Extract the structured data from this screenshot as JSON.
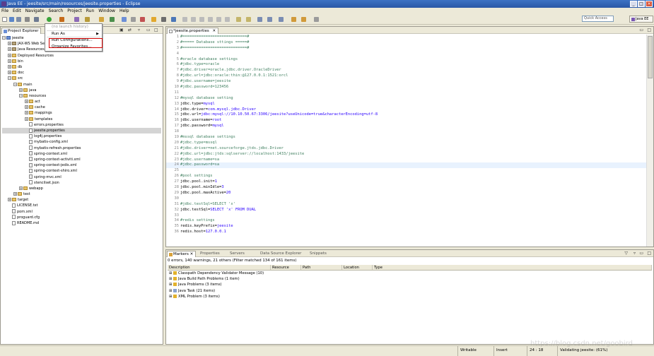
{
  "window": {
    "title": "Java EE - jeesite/src/main/resources/jeesite.properties - Eclipse",
    "controls": [
      "_",
      "□",
      "×"
    ]
  },
  "menubar": [
    "File",
    "Edit",
    "Navigate",
    "Search",
    "Project",
    "Run",
    "Window",
    "Help"
  ],
  "toolbar": {
    "quick_access_placeholder": "Quick Access",
    "perspective": "Java EE"
  },
  "explorer": {
    "tab_label": "Project Explorer",
    "tree": [
      {
        "label": "jeesite",
        "depth": 0,
        "toggle": "−",
        "icon": "project"
      },
      {
        "label": "JAX-WS Web Services",
        "depth": 1,
        "toggle": "+",
        "icon": "jar"
      },
      {
        "label": "Java Resources",
        "depth": 1,
        "toggle": "+",
        "icon": "jar"
      },
      {
        "label": "Deployed Resources",
        "depth": 1,
        "toggle": "+",
        "icon": "folder"
      },
      {
        "label": "bin",
        "depth": 1,
        "toggle": "+",
        "icon": "folder"
      },
      {
        "label": "db",
        "depth": 1,
        "toggle": "+",
        "icon": "folder"
      },
      {
        "label": "doc",
        "depth": 1,
        "toggle": "+",
        "icon": "folder"
      },
      {
        "label": "src",
        "depth": 1,
        "toggle": "−",
        "icon": "folder"
      },
      {
        "label": "main",
        "depth": 2,
        "toggle": "−",
        "icon": "folder"
      },
      {
        "label": "java",
        "depth": 3,
        "toggle": "+",
        "icon": "folder"
      },
      {
        "label": "resources",
        "depth": 3,
        "toggle": "−",
        "icon": "folder"
      },
      {
        "label": "act",
        "depth": 4,
        "toggle": "+",
        "icon": "folder"
      },
      {
        "label": "cache",
        "depth": 4,
        "toggle": "+",
        "icon": "folder"
      },
      {
        "label": "mappings",
        "depth": 4,
        "toggle": "+",
        "icon": "folder"
      },
      {
        "label": "templates",
        "depth": 4,
        "toggle": "+",
        "icon": "folder"
      },
      {
        "label": "errors.properties",
        "depth": 4,
        "toggle": "",
        "icon": "file"
      },
      {
        "label": "jeesite.properties",
        "depth": 4,
        "toggle": "",
        "icon": "file",
        "selected": true
      },
      {
        "label": "log4j.properties",
        "depth": 4,
        "toggle": "",
        "icon": "file"
      },
      {
        "label": "mybatis-config.xml",
        "depth": 4,
        "toggle": "",
        "icon": "xml"
      },
      {
        "label": "mybatis-refresh.properties",
        "depth": 4,
        "toggle": "",
        "icon": "file"
      },
      {
        "label": "spring-context.xml",
        "depth": 4,
        "toggle": "",
        "icon": "xml"
      },
      {
        "label": "spring-context-activiti.xml",
        "depth": 4,
        "toggle": "",
        "icon": "xml"
      },
      {
        "label": "spring-context-jedis.xml",
        "depth": 4,
        "toggle": "",
        "icon": "xml"
      },
      {
        "label": "spring-context-shiro.xml",
        "depth": 4,
        "toggle": "",
        "icon": "xml"
      },
      {
        "label": "spring-mvc.xml",
        "depth": 4,
        "toggle": "",
        "icon": "xml"
      },
      {
        "label": "stencilset.json",
        "depth": 4,
        "toggle": "",
        "icon": "file"
      },
      {
        "label": "webapp",
        "depth": 3,
        "toggle": "+",
        "icon": "folder"
      },
      {
        "label": "test",
        "depth": 2,
        "toggle": "+",
        "icon": "folder"
      },
      {
        "label": "target",
        "depth": 1,
        "toggle": "+",
        "icon": "folder"
      },
      {
        "label": "LICENSE.txt",
        "depth": 1,
        "toggle": "",
        "icon": "file"
      },
      {
        "label": "pom.xml",
        "depth": 1,
        "toggle": "",
        "icon": "xml"
      },
      {
        "label": "proguard.cfg",
        "depth": 1,
        "toggle": "",
        "icon": "file"
      },
      {
        "label": "README.md",
        "depth": 1,
        "toggle": "",
        "icon": "file"
      }
    ]
  },
  "context_menu": {
    "items": [
      {
        "label": "(no launch history)",
        "disabled": true
      },
      {
        "label": "Run As",
        "submenu": true
      },
      {
        "label": "Run Configurations..."
      },
      {
        "label": "Organize Favorites..."
      }
    ]
  },
  "editor": {
    "tab_label": "*jeesite.properties",
    "current_line": 24,
    "lines": [
      {
        "n": "1",
        "text": "#============================#",
        "kind": "com"
      },
      {
        "n": "2",
        "text": "#===== Database sttings =====#",
        "kind": "com"
      },
      {
        "n": "3",
        "text": "#============================#",
        "kind": "com"
      },
      {
        "n": "4",
        "text": "",
        "kind": "plain"
      },
      {
        "n": "5",
        "text": "#oracle database settings",
        "kind": "com"
      },
      {
        "n": "6",
        "text": "#jdbc.type=oracle",
        "kind": "com"
      },
      {
        "n": "7",
        "text": "#jdbc.driver=oracle.jdbc.driver.OracleDriver",
        "kind": "com"
      },
      {
        "n": "8",
        "text": "#jdbc.url=jdbc:oracle:thin:@127.0.0.1:1521:orcl",
        "kind": "com"
      },
      {
        "n": "9",
        "text": "#jdbc.username=jeesite",
        "kind": "com"
      },
      {
        "n": "10",
        "text": "#jdbc.password=123456",
        "kind": "com"
      },
      {
        "n": "11",
        "text": "",
        "kind": "plain"
      },
      {
        "n": "12",
        "text": "#mysql database setting",
        "kind": "com"
      },
      {
        "n": "13",
        "key": "jdbc.type=",
        "val": "mysql",
        "kind": "kv"
      },
      {
        "n": "14",
        "key": "jdbc.driver=",
        "val": "com.mysql.jdbc.Driver",
        "kind": "kv"
      },
      {
        "n": "15",
        "key": "jdbc.url=",
        "val": "jdbc:mysql://10.10.50.67:3306/jeesite?useUnicode=true&characterEncoding=utf-8",
        "kind": "kv"
      },
      {
        "n": "16",
        "key": "jdbc.username=",
        "val": "root",
        "kind": "kv"
      },
      {
        "n": "17",
        "key": "jdbc.password=",
        "val": "mysql",
        "kind": "kv"
      },
      {
        "n": "18",
        "text": "",
        "kind": "plain"
      },
      {
        "n": "19",
        "text": "#mssql database settings",
        "kind": "com"
      },
      {
        "n": "20",
        "text": "#jdbc.type=mssql",
        "kind": "com"
      },
      {
        "n": "21",
        "text": "#jdbc.driver=net.sourceforge.jtds.jdbc.Driver",
        "kind": "com"
      },
      {
        "n": "22",
        "text": "#jdbc.url=jdbc:jtds:sqlserver://localhost:1433/jeesite",
        "kind": "com"
      },
      {
        "n": "23",
        "text": "#jdbc.username=sa",
        "kind": "com"
      },
      {
        "n": "24",
        "text": "#jdbc.password=sa",
        "kind": "com"
      },
      {
        "n": "25",
        "text": "",
        "kind": "plain"
      },
      {
        "n": "26",
        "text": "#pool settings",
        "kind": "com"
      },
      {
        "n": "27",
        "key": "jdbc.pool.init=",
        "val": "1",
        "kind": "kv"
      },
      {
        "n": "28",
        "key": "jdbc.pool.minIdle=",
        "val": "3",
        "kind": "kv"
      },
      {
        "n": "29",
        "key": "jdbc.pool.maxActive=",
        "val": "20",
        "kind": "kv"
      },
      {
        "n": "30",
        "text": "",
        "kind": "plain"
      },
      {
        "n": "31",
        "text": "#jdbc.testSql=SELECT 'x'",
        "kind": "com"
      },
      {
        "n": "32",
        "key": "jdbc.testSql=",
        "val": "SELECT 'x' FROM DUAL",
        "kind": "kv"
      },
      {
        "n": "33",
        "text": "",
        "kind": "plain"
      },
      {
        "n": "34",
        "text": "#redis settings",
        "kind": "com"
      },
      {
        "n": "35",
        "key": "redis.keyPrefix=",
        "val": "jeesite",
        "kind": "kv"
      },
      {
        "n": "36",
        "key": "redis.host=",
        "val": "127.0.0.1",
        "kind": "kv"
      }
    ]
  },
  "bottom": {
    "tabs": [
      "Markers",
      "Properties",
      "Servers",
      "Data Source Explorer",
      "Snippets"
    ],
    "summary": "0 errors, 140 warnings, 21 others (Filter matched 134 of 161 items)",
    "columns": [
      "Description",
      "Resource",
      "Path",
      "Location",
      "Type"
    ],
    "rows": [
      {
        "label": "Classpath Dependency Validator Message (10)",
        "icon": "warn"
      },
      {
        "label": "Java Build Path Problems (1 item)",
        "icon": "warn"
      },
      {
        "label": "Java Problems (3 items)",
        "icon": "warn"
      },
      {
        "label": "Java Task (21 items)",
        "icon": "task"
      },
      {
        "label": "XML Problem (3 items)",
        "icon": "warn"
      }
    ]
  },
  "status": {
    "writable": "Writable",
    "mode": "Insert",
    "position": "24 : 18",
    "job": "Validating jeesite: (61%)"
  },
  "watermark": "https://blog.csdn.net/goobird"
}
